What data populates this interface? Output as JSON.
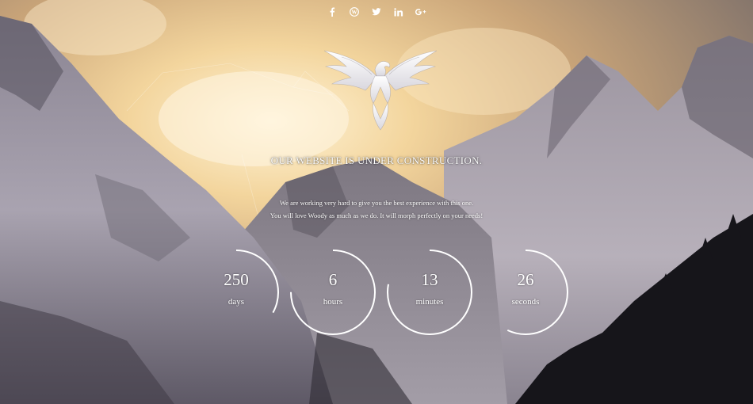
{
  "social": [
    {
      "icon": "facebook-icon",
      "glyph": "f"
    },
    {
      "icon": "wordpress-icon",
      "glyph": "W"
    },
    {
      "icon": "twitter-icon",
      "glyph": "t"
    },
    {
      "icon": "linkedin-icon",
      "glyph": "in"
    },
    {
      "icon": "google-plus-icon",
      "glyph": "G+"
    }
  ],
  "headline": "OUR WEBSITE IS UNDER CONSTRUCTION.",
  "lead_line_1": "We are working very hard to give you the best experience with this one.",
  "lead_line_2": "You will love Woody as much as we do. It will morph perfectly on your needs!",
  "countdown": [
    {
      "value": "250",
      "unit": "days",
      "fraction": 0.33
    },
    {
      "value": "6",
      "unit": "hours",
      "fraction": 0.75
    },
    {
      "value": "13",
      "unit": "minutes",
      "fraction": 0.78
    },
    {
      "value": "26",
      "unit": "seconds",
      "fraction": 0.57
    }
  ],
  "colors": {
    "ring": "#ffffff",
    "text": "#ffffff"
  }
}
